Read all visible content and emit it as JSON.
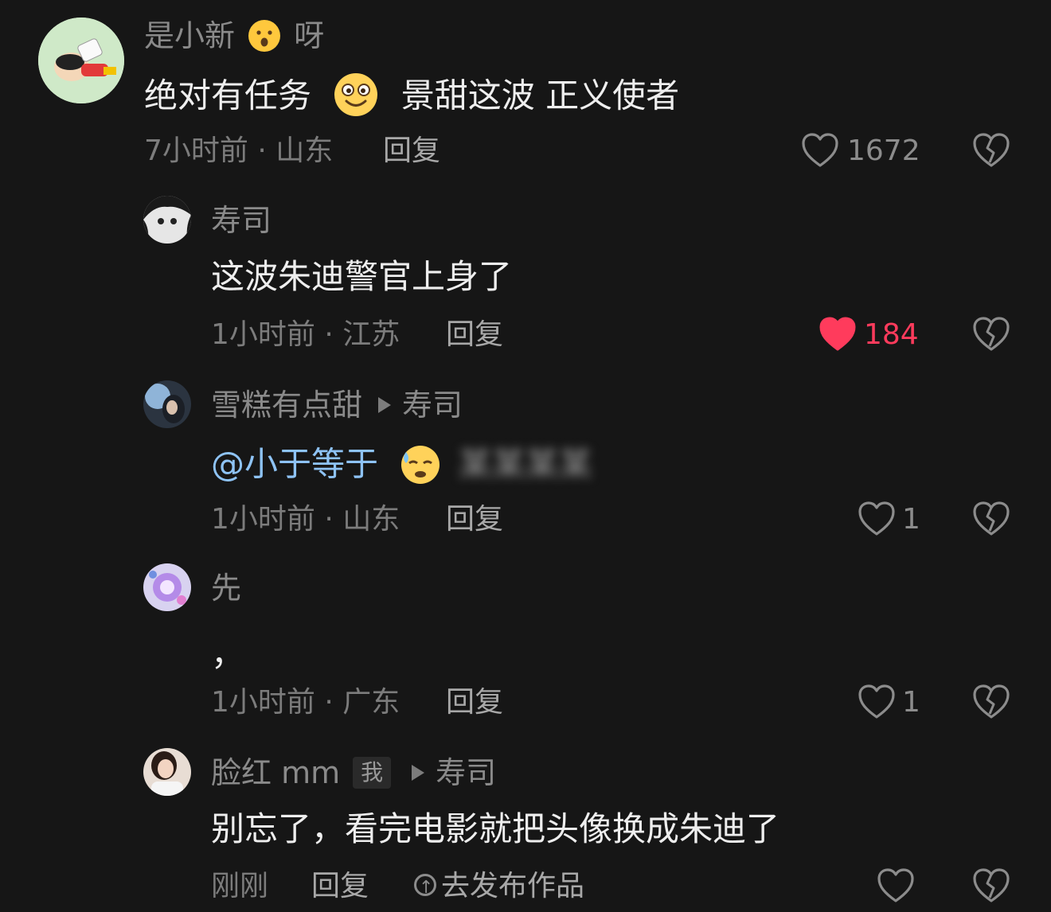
{
  "comment": {
    "username": "是小新",
    "username_suffix": "呀",
    "text_a": "绝对有任务",
    "text_b": "景甜这波 正义使者",
    "meta": "7小时前 · 山东",
    "reply_label": "回复",
    "like_count": "1672"
  },
  "replies": [
    {
      "username": "寿司",
      "text": "这波朱迪警官上身了",
      "meta": "1小时前 · 江苏",
      "reply_label": "回复",
      "like_count": "184",
      "liked": true
    },
    {
      "username": "雪糕有点甜",
      "reply_to": "寿司",
      "mention": "@小于等于",
      "blurred_text": "某某某某",
      "meta": "1小时前 · 山东",
      "reply_label": "回复",
      "like_count": "1"
    },
    {
      "username": "先",
      "text": "，",
      "meta": "1小时前 · 广东",
      "reply_label": "回复",
      "like_count": "1"
    },
    {
      "username": "脸红 mm",
      "badge": "我",
      "reply_to": "寿司",
      "text": "别忘了，看完电影就把头像换成朱迪了",
      "meta": "刚刚",
      "reply_label": "回复",
      "post_label": "去发布作品"
    }
  ],
  "colors": {
    "background": "#161616",
    "liked": "#ff3b5c",
    "mention": "#8ec3f5"
  }
}
